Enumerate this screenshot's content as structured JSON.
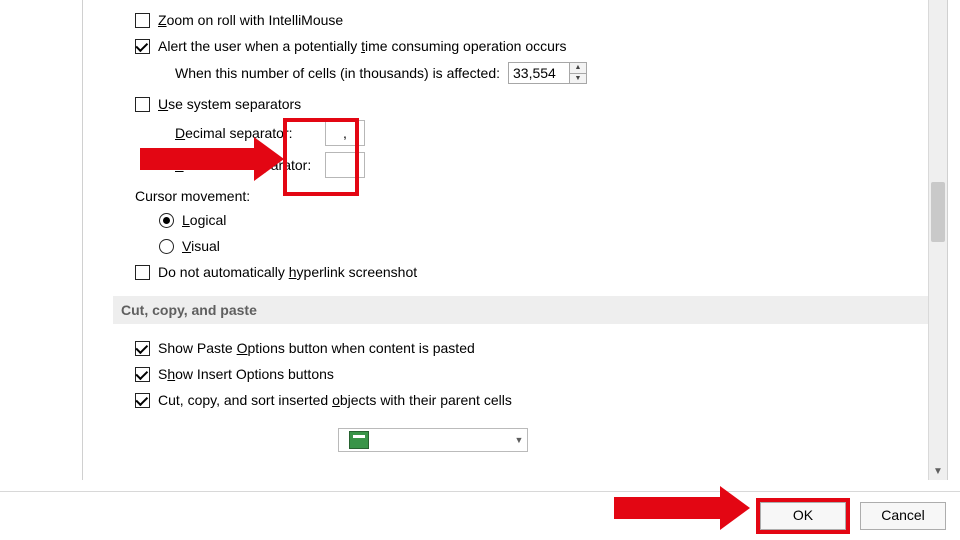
{
  "options": {
    "zoom_on_roll": "Zoom on roll with IntelliMouse",
    "alert_time": "Alert the user when a potentially time consuming operation occurs",
    "cells_affected_label": "When this number of cells (in thousands) is affected:",
    "cells_affected_value": "33,554",
    "use_system_separators": "Use system separators",
    "decimal_sep_label": "Decimal separator:",
    "decimal_sep_value": ",",
    "thousands_sep_label": "Thousands separator:",
    "thousands_sep_value": "",
    "cursor_movement_label": "Cursor movement:",
    "cursor_logical": "Logical",
    "cursor_visual": "Visual",
    "no_auto_hyperlink": "Do not automatically hyperlink screenshot"
  },
  "section": {
    "cut_copy_paste": "Cut, copy, and paste"
  },
  "paste": {
    "show_paste_options": "Show Paste Options button when content is pasted",
    "show_insert_options": "Show Insert Options buttons",
    "cut_copy_sort_objects": "Cut, copy, and sort inserted objects with their parent cells"
  },
  "buttons": {
    "ok": "OK",
    "cancel": "Cancel"
  },
  "accent_color": "#e30613"
}
